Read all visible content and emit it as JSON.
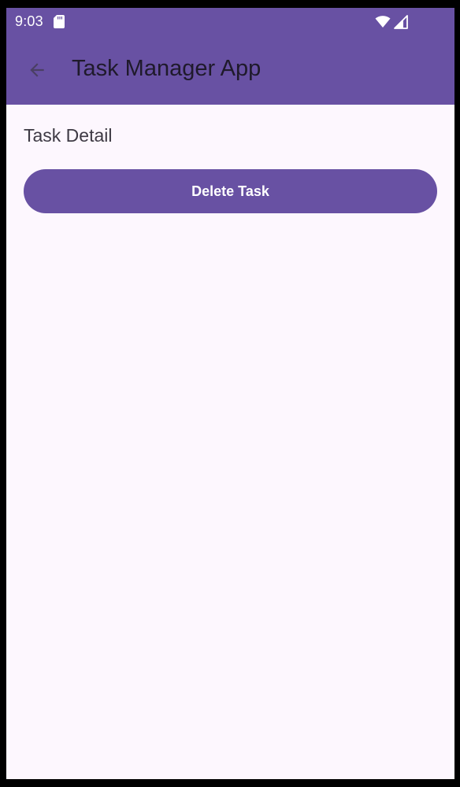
{
  "status_bar": {
    "time": "9:03",
    "icons": [
      "sd-card-icon",
      "wifi-icon",
      "signal-icon"
    ]
  },
  "app_bar": {
    "title": "Task Manager App",
    "back_icon": "arrow-back-icon"
  },
  "main": {
    "section_title": "Task Detail",
    "delete_button_label": "Delete Task"
  },
  "colors": {
    "primary": "#6851a3",
    "background": "#fdf7fe",
    "title_text": "#1f1a2b",
    "body_text": "#3e3a44",
    "on_primary": "#ffffff"
  }
}
